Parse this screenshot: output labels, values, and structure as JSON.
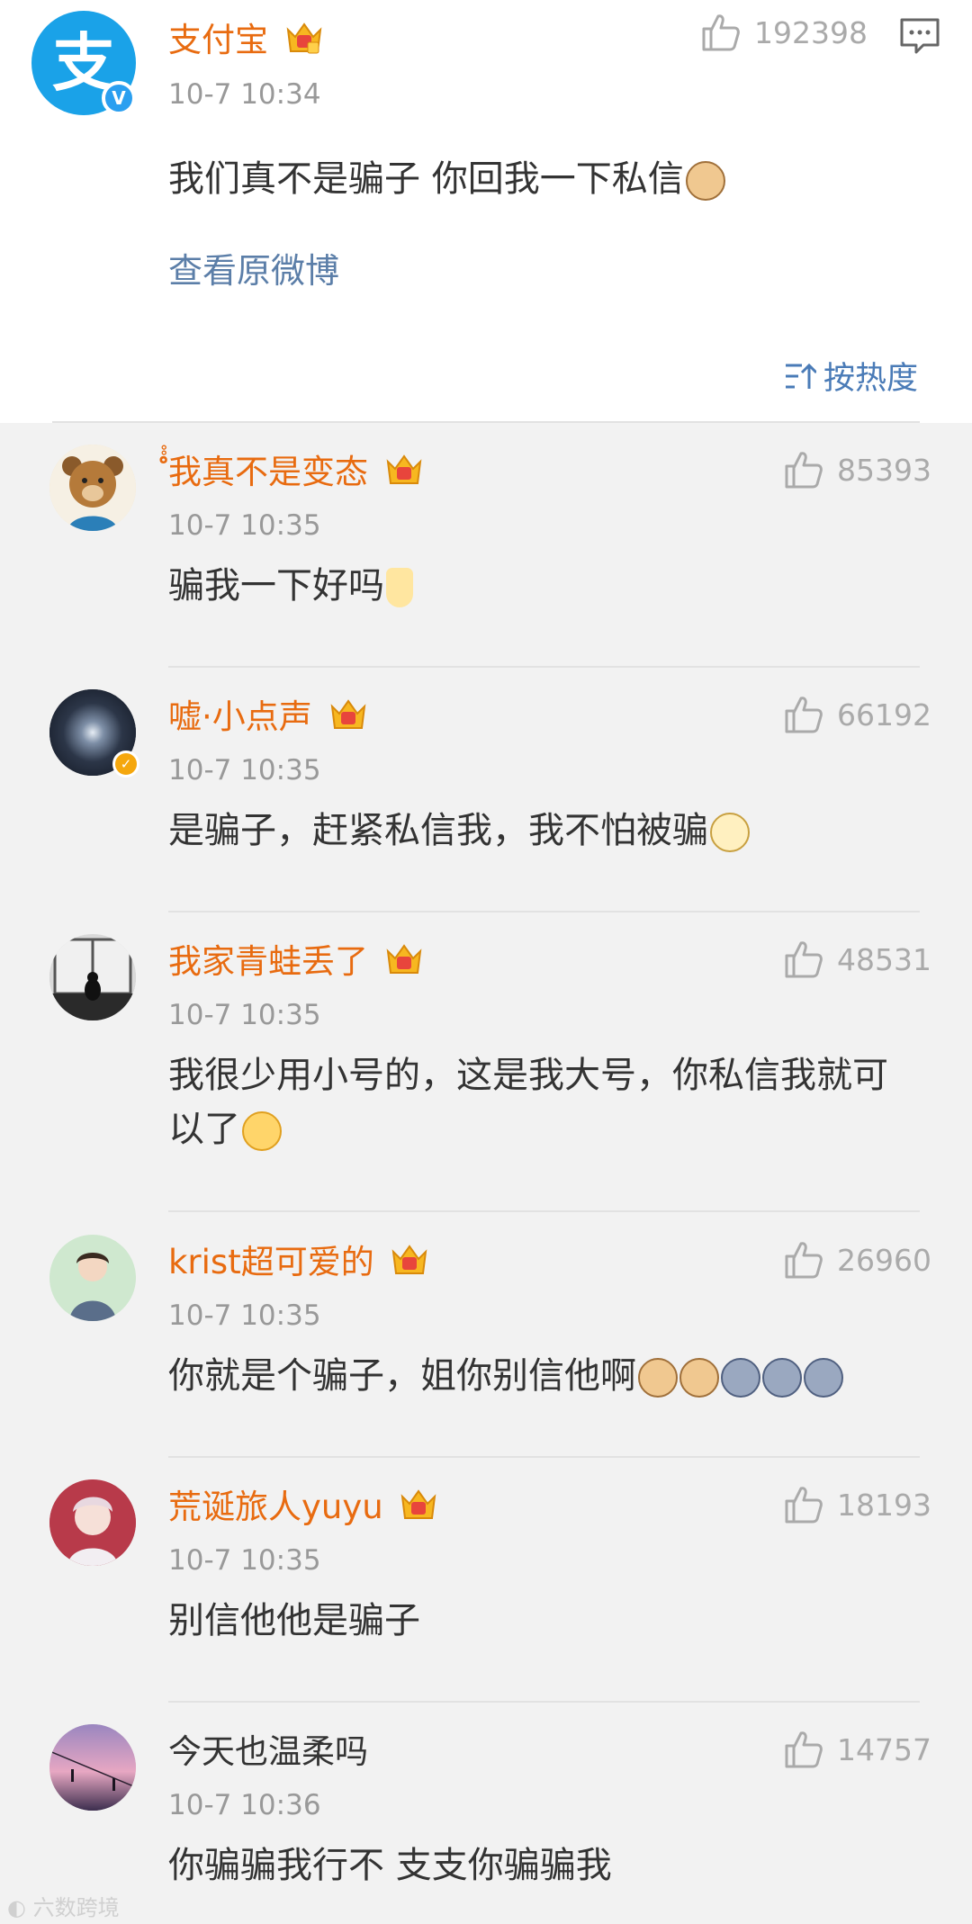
{
  "main_post": {
    "author": "支付宝",
    "time": "10-7 10:34",
    "likes": "192398",
    "content": "我们真不是骗子 你回我一下私信",
    "view_original": "查看原微博",
    "avatar_glyph": "支"
  },
  "sort": {
    "label": "按热度"
  },
  "comments": [
    {
      "author": "ํํํ我真不是变态",
      "time": "10-7 10:35",
      "likes": "85393",
      "content": "骗我一下好吗"
    },
    {
      "author": "嘘·小点声",
      "time": "10-7 10:35",
      "likes": "66192",
      "content": "是骗子，赶紧私信我，我不怕被骗"
    },
    {
      "author": "我家青蛙丢了",
      "time": "10-7 10:35",
      "likes": "48531",
      "content_line1": "我很少用小号的，这是我大号，你私信我就可",
      "content_line2": "以了"
    },
    {
      "author": "krist超可爱的",
      "time": "10-7 10:35",
      "likes": "26960",
      "content": "你就是个骗子，姐你别信他啊"
    },
    {
      "author": "荒诞旅人yuyu",
      "time": "10-7 10:35",
      "likes": "18193",
      "content": "别信他他是骗子"
    },
    {
      "author": "今天也温柔吗",
      "time": "10-7 10:36",
      "likes": "14757",
      "content": "你骗骗我行不 支支你骗骗我"
    }
  ],
  "watermark": "六数跨境",
  "colors": {
    "author": "#e86b10",
    "link": "#5b7ea8",
    "sort": "#4a7bb7",
    "alipay_blue": "#1aa2e8",
    "muted": "#999999"
  }
}
